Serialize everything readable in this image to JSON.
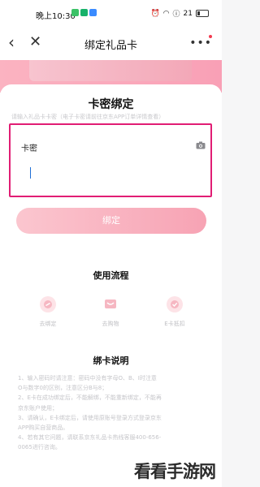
{
  "status_bar": {
    "time": "晚上10:30",
    "battery": "21"
  },
  "nav": {
    "back_icon": "chevron-left-icon",
    "close_icon": "close-icon",
    "title": "绑定礼品卡",
    "more_icon": "more-icon"
  },
  "bind_panel": {
    "title": "卡密绑定",
    "hint": "请输入礼品卡卡密（电子卡密请前往京东APP订单详情查看）",
    "field_label": "卡密",
    "bind_button": "绑定"
  },
  "process": {
    "title": "使用流程",
    "steps": [
      {
        "label": "去绑定",
        "icon": "link-icon"
      },
      {
        "label": "去购物",
        "icon": "cart-icon"
      },
      {
        "label": "E卡抵扣",
        "icon": "check-icon"
      }
    ]
  },
  "instructions": {
    "title": "绑卡说明",
    "lines": [
      "1、输入密码时请注意：密码中没有字母O、B、I时注意",
      "   O与数字0的区别，注意区分B与8；",
      "2、E卡在成功绑定后，不能解绑，不能重新绑定，不能再",
      "   京东账户使用；",
      "3、请确认，E卡绑定后，请使用原账号登录方式登录京东",
      "   APP购买自营商品。",
      "4、若有其它问题，请联系京东礼品卡热线客服400-656-",
      "   0065进行咨询。"
    ]
  },
  "watermark": "看看手游网",
  "colors": {
    "accent": "#e11d74",
    "button": "#f7a3b4",
    "banner": "#f9a0b6"
  }
}
